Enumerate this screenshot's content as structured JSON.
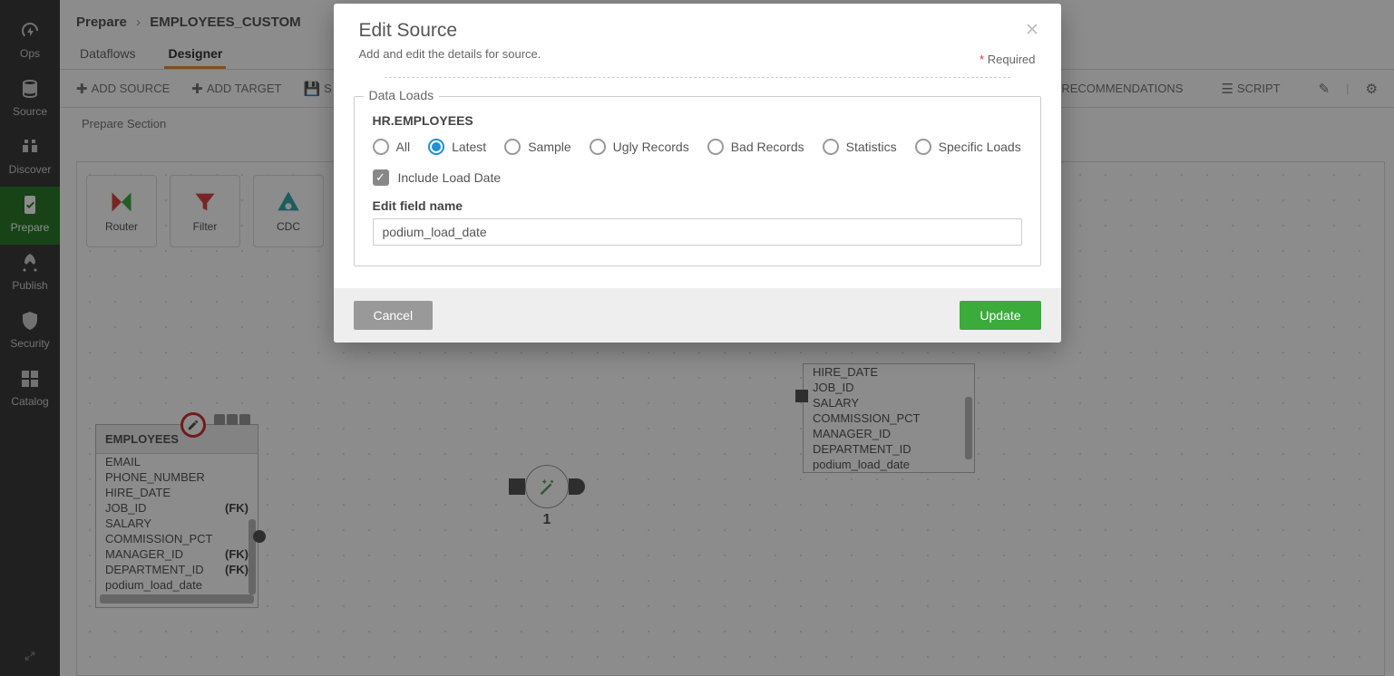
{
  "sidebar": {
    "items": [
      {
        "key": "ops",
        "label": "Ops"
      },
      {
        "key": "source",
        "label": "Source"
      },
      {
        "key": "discover",
        "label": "Discover"
      },
      {
        "key": "prepare",
        "label": "Prepare",
        "selected": true
      },
      {
        "key": "publish",
        "label": "Publish"
      },
      {
        "key": "security",
        "label": "Security"
      },
      {
        "key": "catalog",
        "label": "Catalog"
      }
    ]
  },
  "breadcrumb": {
    "root": "Prepare",
    "leaf": "EMPLOYEES_CUSTOM"
  },
  "tabs": {
    "items": [
      {
        "label": "Dataflows"
      },
      {
        "label": "Designer",
        "active": true
      }
    ]
  },
  "toolbar": {
    "add_source": "ADD SOURCE",
    "add_target": "ADD TARGET",
    "save_prefix": "S",
    "recommendations": "RECOMMENDATIONS",
    "script": "SCRIPT"
  },
  "section_label": "Prepare Section",
  "palette": {
    "items": [
      {
        "label": "Router"
      },
      {
        "label": "Filter"
      },
      {
        "label": "CDC"
      }
    ]
  },
  "source_node": {
    "title": "EMPLOYEES",
    "rows": [
      {
        "name": "EMAIL"
      },
      {
        "name": "PHONE_NUMBER"
      },
      {
        "name": "HIRE_DATE"
      },
      {
        "name": "JOB_ID",
        "fk": true
      },
      {
        "name": "SALARY"
      },
      {
        "name": "COMMISSION_PCT"
      },
      {
        "name": "MANAGER_ID",
        "fk": true
      },
      {
        "name": "DEPARTMENT_ID",
        "fk": true
      },
      {
        "name": "podium_load_date"
      }
    ]
  },
  "target_node": {
    "rows": [
      {
        "name": "HIRE_DATE"
      },
      {
        "name": "JOB_ID"
      },
      {
        "name": "SALARY"
      },
      {
        "name": "COMMISSION_PCT"
      },
      {
        "name": "MANAGER_ID"
      },
      {
        "name": "DEPARTMENT_ID"
      },
      {
        "name": "podium_load_date"
      }
    ]
  },
  "xform_label": "1",
  "modal": {
    "title": "Edit Source",
    "subtitle": "Add and edit the details for source.",
    "required_label": "Required",
    "fieldset_legend": "Data Loads",
    "source_name": "HR.EMPLOYEES",
    "radio_options": [
      {
        "key": "all",
        "label": "All"
      },
      {
        "key": "latest",
        "label": "Latest",
        "selected": true
      },
      {
        "key": "sample",
        "label": "Sample"
      },
      {
        "key": "ugly",
        "label": "Ugly Records"
      },
      {
        "key": "bad",
        "label": "Bad Records"
      },
      {
        "key": "stats",
        "label": "Statistics"
      },
      {
        "key": "specific",
        "label": "Specific Loads"
      }
    ],
    "include_load_date": {
      "checked": true,
      "label": "Include Load Date"
    },
    "field_name_label": "Edit field name",
    "field_name_value": "podium_load_date",
    "cancel": "Cancel",
    "update": "Update"
  }
}
